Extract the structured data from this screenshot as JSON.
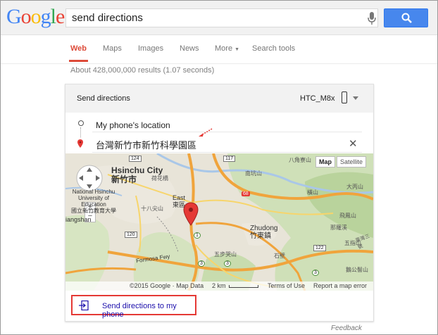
{
  "header": {
    "logo_text": "Google",
    "logo_colors": [
      "#4285f4",
      "#ea4335",
      "#fbbc05",
      "#4285f4",
      "#34a853",
      "#ea4335"
    ],
    "search_value": "send directions",
    "accent": "#4787ed"
  },
  "tabs": [
    {
      "label": "Web"
    },
    {
      "label": "Maps"
    },
    {
      "label": "Images"
    },
    {
      "label": "News"
    },
    {
      "label": "More"
    },
    {
      "label": "Search tools"
    }
  ],
  "stats": "About 428,000,000 results (1.07 seconds)",
  "card": {
    "title": "Send directions",
    "device": "HTC_M8x",
    "from": "My phone's location",
    "to": "台灣新竹市新竹科學園區",
    "send_label": "Send directions to my phone"
  },
  "map": {
    "type_map": "Map",
    "type_satellite": "Satellite",
    "labels": {
      "hsinchu_city": "Hsinchu City",
      "hsinchu_city_zh": "新竹市",
      "university": "National Hsinchu University of Education",
      "university_zh": "國立新竹教育大學",
      "east": "East",
      "east_zh": "東區",
      "shiba": "十八尖山",
      "xiangshan": "iangshan",
      "formosa": "Formosa Fwy",
      "zhudong": "Zhudong",
      "zhudong_zh": "竹東鎮",
      "wubu": "五步哭山",
      "rt117": "117",
      "rt120": "120",
      "rt68": "68",
      "rt1": "1",
      "rt3a": "3",
      "rt3b": "3",
      "rt122": "122",
      "rt124": "124",
      "rt3c": "3",
      "fuxing": "八角寮山",
      "zhuyang": "大丙山",
      "lishan": "飛鳳山",
      "shiguang": "五指山",
      "ridge": "鵝公髻山",
      "hengshan": "橫山",
      "shangping": "那羅溪",
      "nandizh": "南坑山",
      "eastzh": "石壁",
      "hsinchu_south": "荷花橋",
      "taiwan3": "臺灣三號"
    },
    "footer_copyright": "©2015 Google · Map Data",
    "footer_scale": "2 km",
    "footer_terms": "Terms of Use",
    "footer_report": "Report a map error"
  },
  "feedback": "Feedback"
}
